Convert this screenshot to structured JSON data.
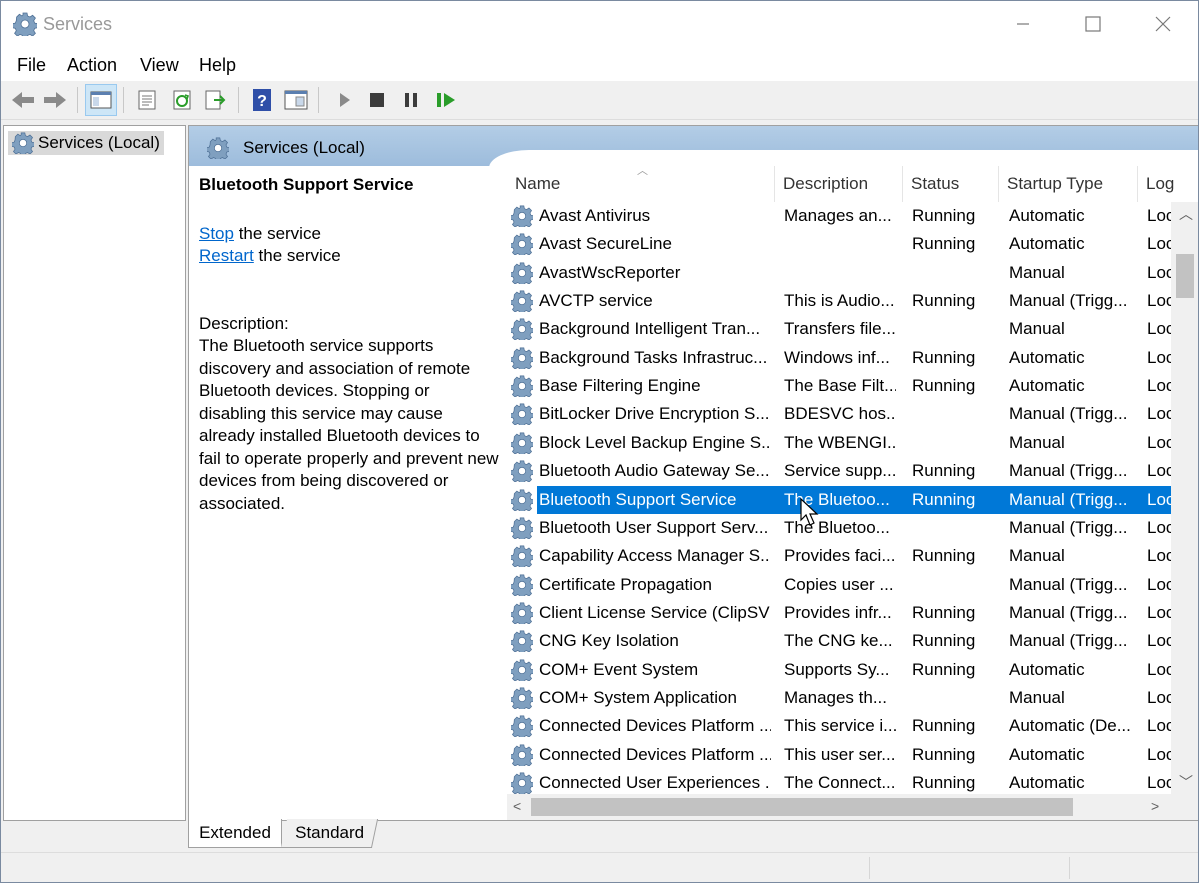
{
  "window": {
    "title": "Services"
  },
  "menu": [
    "File",
    "Action",
    "View",
    "Help"
  ],
  "tree": {
    "item": "Services (Local)"
  },
  "pane": {
    "title": "Services (Local)"
  },
  "desc": {
    "title": "Bluetooth Support Service",
    "stop_link": "Stop",
    "stop_rest": " the service",
    "restart_link": "Restart",
    "restart_rest": " the service",
    "label": "Description:",
    "text": "The Bluetooth service supports discovery and association of remote Bluetooth devices.  Stopping or disabling this service may cause already installed Bluetooth devices to fail to operate properly and prevent new devices from being discovered or associated."
  },
  "columns": {
    "name": "Name",
    "description": "Description",
    "status": "Status",
    "startup": "Startup Type",
    "log": "Log"
  },
  "rows": [
    {
      "name": "Avast Antivirus",
      "description": "Manages an...",
      "status": "Running",
      "startup": "Automatic",
      "log": "Loc"
    },
    {
      "name": "Avast SecureLine",
      "description": "",
      "status": "Running",
      "startup": "Automatic",
      "log": "Loc"
    },
    {
      "name": "AvastWscReporter",
      "description": "",
      "status": "",
      "startup": "Manual",
      "log": "Loc"
    },
    {
      "name": "AVCTP service",
      "description": "This is Audio...",
      "status": "Running",
      "startup": "Manual (Trigg...",
      "log": "Loc"
    },
    {
      "name": "Background Intelligent Tran...",
      "description": "Transfers file...",
      "status": "",
      "startup": "Manual",
      "log": "Loc"
    },
    {
      "name": "Background Tasks Infrastruc...",
      "description": "Windows inf...",
      "status": "Running",
      "startup": "Automatic",
      "log": "Loc"
    },
    {
      "name": "Base Filtering Engine",
      "description": "The Base Filt...",
      "status": "Running",
      "startup": "Automatic",
      "log": "Loc"
    },
    {
      "name": "BitLocker Drive Encryption S...",
      "description": "BDESVC hos...",
      "status": "",
      "startup": "Manual (Trigg...",
      "log": "Loc"
    },
    {
      "name": "Block Level Backup Engine S...",
      "description": "The WBENGI...",
      "status": "",
      "startup": "Manual",
      "log": "Loc"
    },
    {
      "name": "Bluetooth Audio Gateway Se...",
      "description": "Service supp...",
      "status": "Running",
      "startup": "Manual (Trigg...",
      "log": "Loc"
    },
    {
      "name": "Bluetooth Support Service",
      "description": "The Bluetoo...",
      "status": "Running",
      "startup": "Manual (Trigg...",
      "log": "Loc",
      "selected": true
    },
    {
      "name": "Bluetooth User Support Serv...",
      "description": "The Bluetoo...",
      "status": "",
      "startup": "Manual (Trigg...",
      "log": "Loc"
    },
    {
      "name": "Capability Access Manager S...",
      "description": "Provides faci...",
      "status": "Running",
      "startup": "Manual",
      "log": "Loc"
    },
    {
      "name": "Certificate Propagation",
      "description": "Copies user ...",
      "status": "",
      "startup": "Manual (Trigg...",
      "log": "Loc"
    },
    {
      "name": "Client License Service (ClipSV",
      "description": "Provides infr...",
      "status": "Running",
      "startup": "Manual (Trigg...",
      "log": "Loc"
    },
    {
      "name": "CNG Key Isolation",
      "description": "The CNG ke...",
      "status": "Running",
      "startup": "Manual (Trigg...",
      "log": "Loc"
    },
    {
      "name": "COM+ Event System",
      "description": "Supports Sy...",
      "status": "Running",
      "startup": "Automatic",
      "log": "Loc"
    },
    {
      "name": "COM+ System Application",
      "description": "Manages th...",
      "status": "",
      "startup": "Manual",
      "log": "Loc"
    },
    {
      "name": "Connected Devices Platform ...",
      "description": "This service i...",
      "status": "Running",
      "startup": "Automatic (De...",
      "log": "Loc"
    },
    {
      "name": "Connected Devices Platform ...",
      "description": "This user ser...",
      "status": "Running",
      "startup": "Automatic",
      "log": "Loc"
    },
    {
      "name": "Connected User Experiences ...",
      "description": "The Connect...",
      "status": "Running",
      "startup": "Automatic",
      "log": "Loc"
    }
  ],
  "tabs": {
    "extended": "Extended",
    "standard": "Standard"
  },
  "colors": {
    "selection": "#0078d7",
    "header": "#a9c6e2",
    "link": "#0066cc"
  }
}
